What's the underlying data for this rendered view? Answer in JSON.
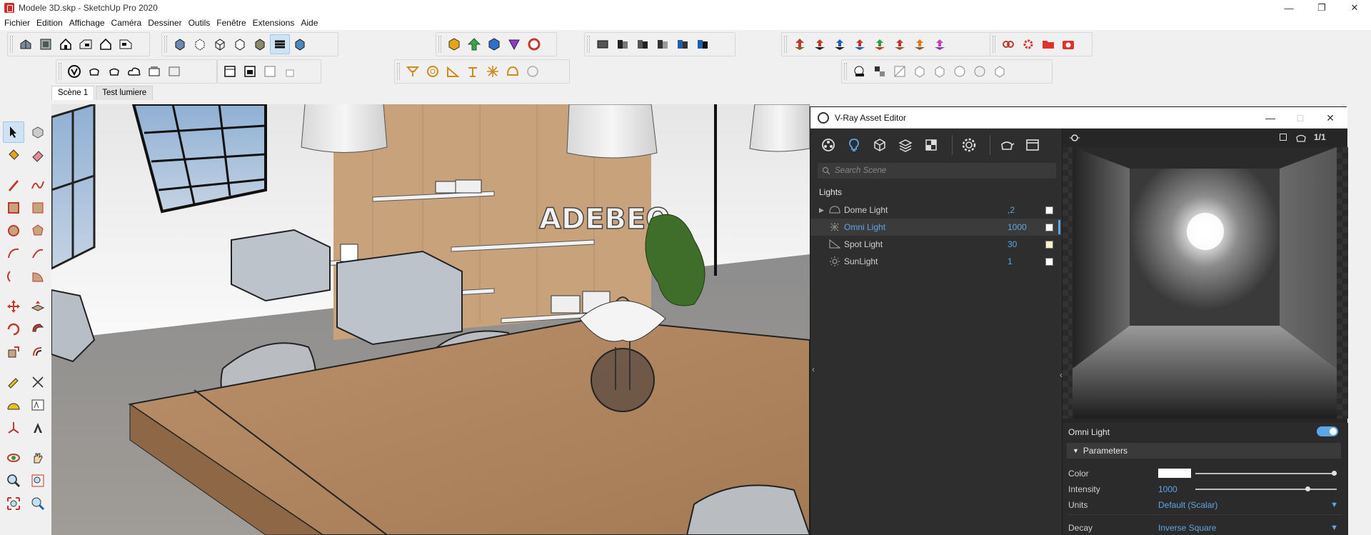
{
  "window": {
    "title": "Modele 3D.skp - SketchUp Pro 2020",
    "minimize": "—",
    "maximize": "❐",
    "close": "✕"
  },
  "menu": [
    "Fichier",
    "Edition",
    "Affichage",
    "Caméra",
    "Dessiner",
    "Outils",
    "Fenêtre",
    "Extensions",
    "Aide"
  ],
  "scene_tabs": [
    {
      "label": "Scène 1",
      "active": true
    },
    {
      "label": "Test lumiere",
      "active": false
    }
  ],
  "vray": {
    "title": "V-Ray Asset Editor",
    "search_placeholder": "Search Scene",
    "section": "Lights",
    "lights": [
      {
        "name": "Dome Light",
        "value": ",2",
        "swatch": "#ffffff",
        "expandable": true,
        "selected": false,
        "icon": "dome-light-icon"
      },
      {
        "name": "Omni Light",
        "value": "1000",
        "swatch": "#ffffff",
        "expandable": false,
        "selected": true,
        "icon": "omni-light-icon"
      },
      {
        "name": "Spot Light",
        "value": "30",
        "swatch": "#fff1c9",
        "expandable": false,
        "selected": false,
        "icon": "spot-light-icon"
      },
      {
        "name": "SunLight",
        "value": "1",
        "swatch": "#ffffff",
        "expandable": false,
        "selected": false,
        "icon": "sun-light-icon"
      }
    ],
    "properties": {
      "title": "Omni Light",
      "enabled": true,
      "section": "Parameters",
      "color_label": "Color",
      "color": "#ffffff",
      "color_slider": 1.0,
      "intensity_label": "Intensity",
      "intensity": "1000",
      "intensity_slider": 0.8,
      "units_label": "Units",
      "units": "Default (Scalar)",
      "decay_label": "Decay",
      "decay": "Inverse Square"
    },
    "preview_ratio": "1/1"
  },
  "scene_text": {
    "sign": "ADEBEO"
  },
  "colors": {
    "accent": "#5aa6e6",
    "panel_bg": "#2e2e2e",
    "toolbar_bg": "#f0f0f0"
  }
}
